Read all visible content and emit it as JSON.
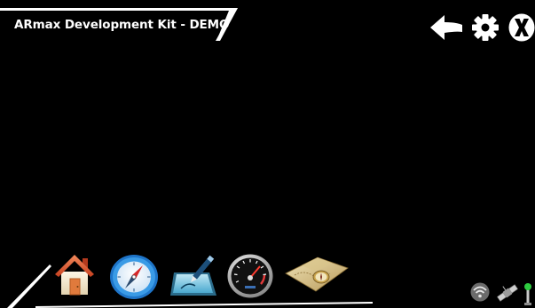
{
  "header": {
    "title": "ARmax Development Kit - DEMO"
  },
  "toolbar": {
    "icons": [
      "back-arrow-icon",
      "gear-icon",
      "close-x-icon"
    ]
  },
  "dock": {
    "icons": [
      "home-icon",
      "compass-icon",
      "drawing-tablet-icon",
      "speedometer-icon",
      "treasure-map-icon"
    ]
  },
  "status": {
    "icons": [
      "wifi-icon",
      "satellite-icon",
      "gps-antenna-icon"
    ]
  },
  "colors": {
    "background": "#000000",
    "foreground": "#ffffff",
    "home_roof": "#d9502f",
    "compass_blue": "#1e74c8",
    "map_tan": "#c9b27a",
    "gps_green": "#2ecc40"
  }
}
